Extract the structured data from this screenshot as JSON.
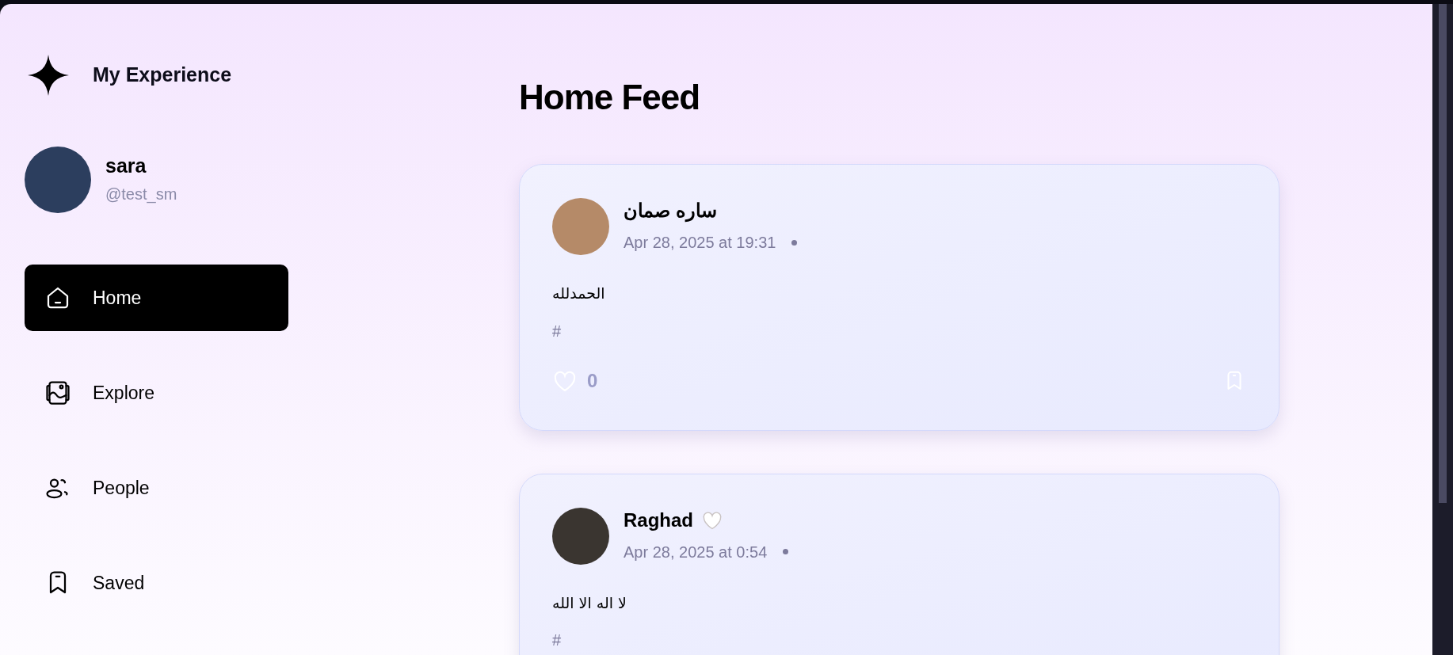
{
  "brand": {
    "name": "My Experience"
  },
  "profile": {
    "name": "sara",
    "handle": "@test_sm"
  },
  "nav": [
    {
      "label": "Home",
      "kind": "home",
      "selected": true
    },
    {
      "label": "Explore",
      "kind": "gallery",
      "selected": false
    },
    {
      "label": "People",
      "kind": "people",
      "selected": false
    },
    {
      "label": "Saved",
      "kind": "bookmark",
      "selected": false
    }
  ],
  "page_title": "Home Feed",
  "posts": [
    {
      "author": "ساره صمان",
      "time": "Apr 28, 2025 at 19:31",
      "text": "الحمدلله",
      "tag": "#",
      "likes": "0",
      "liked": false,
      "saved": false
    },
    {
      "author": "Raghad",
      "heart_badge": true,
      "time": "Apr 28, 2025 at 0:54",
      "text": "لا اله الا الله",
      "tag": "#"
    }
  ]
}
